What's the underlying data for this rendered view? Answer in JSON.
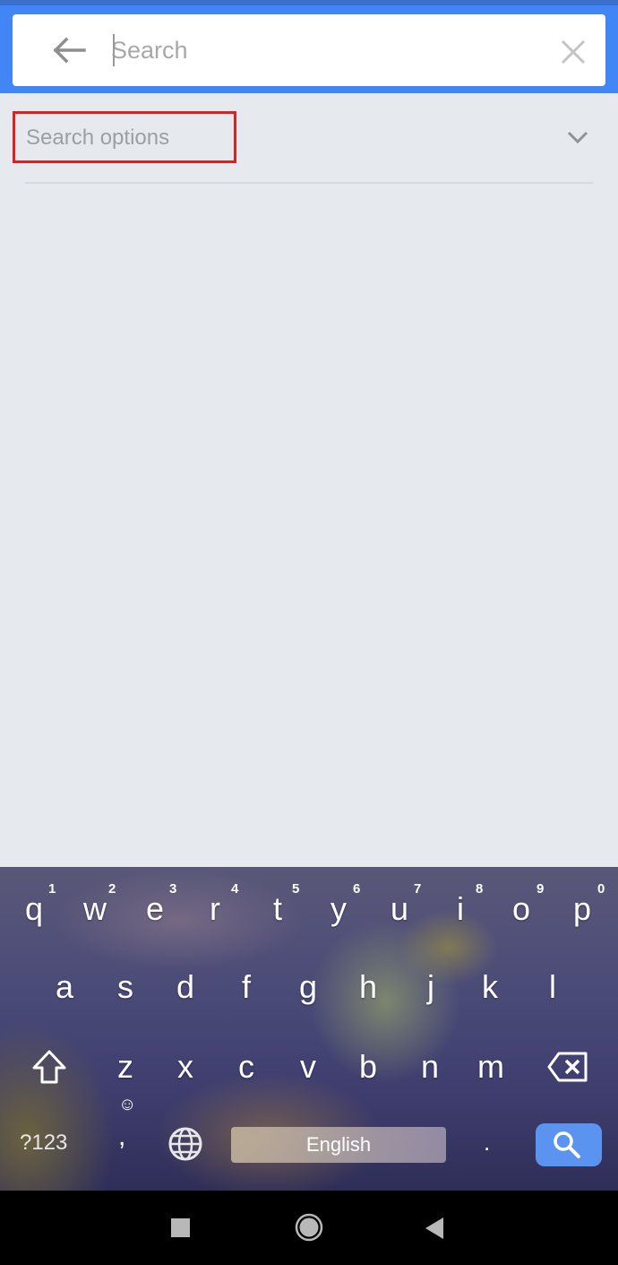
{
  "search_bar": {
    "placeholder": "Search",
    "value": "",
    "back_icon": "arrow-left-icon",
    "clear_icon": "close-icon"
  },
  "search_options": {
    "label": "Search options",
    "expand_icon": "chevron-down-icon",
    "highlight_color": "#e02020"
  },
  "keyboard": {
    "row1": [
      {
        "key": "q",
        "hint": "1"
      },
      {
        "key": "w",
        "hint": "2"
      },
      {
        "key": "e",
        "hint": "3"
      },
      {
        "key": "r",
        "hint": "4"
      },
      {
        "key": "t",
        "hint": "5"
      },
      {
        "key": "y",
        "hint": "6"
      },
      {
        "key": "u",
        "hint": "7"
      },
      {
        "key": "i",
        "hint": "8"
      },
      {
        "key": "o",
        "hint": "9"
      },
      {
        "key": "p",
        "hint": "0"
      }
    ],
    "row2": [
      "a",
      "s",
      "d",
      "f",
      "g",
      "h",
      "j",
      "k",
      "l"
    ],
    "row3": [
      "z",
      "x",
      "c",
      "v",
      "b",
      "n",
      "m"
    ],
    "symbols_label": "?123",
    "comma": ",",
    "emoji_hint": "☺",
    "space_label": "English",
    "period": ".",
    "shift_icon": "shift-icon",
    "delete_icon": "backspace-icon",
    "language_icon": "globe-icon",
    "action_icon": "search-icon",
    "action_color": "#5b93f0"
  },
  "colors": {
    "accent": "#4285f4",
    "background": "#e6e9ed"
  }
}
